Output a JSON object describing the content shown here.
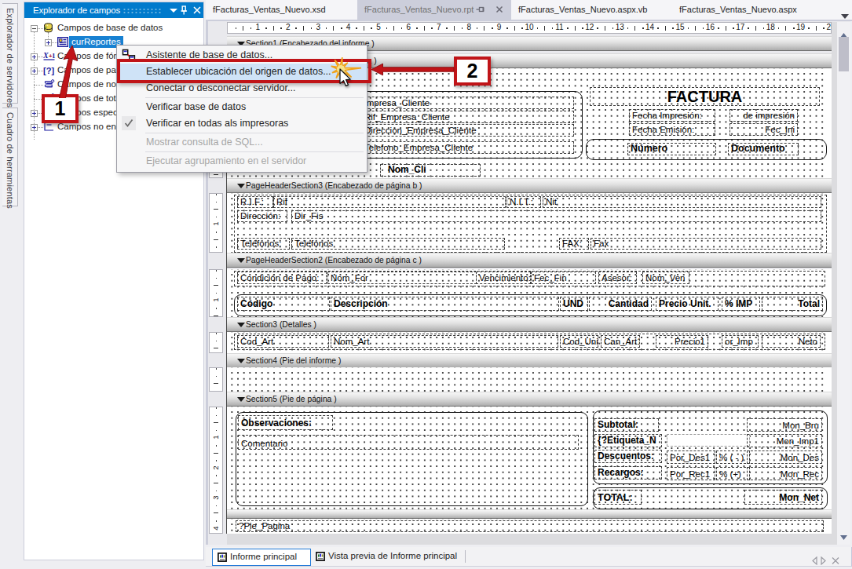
{
  "left_dock": {
    "tabs": [
      {
        "label": "Explorador de servidores"
      },
      {
        "label": "Cuadro de herramientas"
      }
    ]
  },
  "field_explorer": {
    "title": "Explorador de campos",
    "tree": [
      {
        "label": "Campos de base de datos",
        "level": 0,
        "expander": "minus",
        "icon": "database-fields-icon",
        "selected": false
      },
      {
        "label": "curReportes",
        "level": 1,
        "expander": "plus",
        "icon": "cursor-fields-icon",
        "selected": true
      },
      {
        "label": "Campos de fórmula",
        "level": 0,
        "expander": "plus",
        "icon": "formula-fields-icon",
        "selected": false
      },
      {
        "label": "Campos de parámetro",
        "level": 0,
        "expander": "plus",
        "icon": "parameter-fields-icon",
        "selected": false
      },
      {
        "label": "Campos de nombre de grupo",
        "level": 0,
        "expander": "none",
        "icon": "group-name-fields-icon",
        "selected": false
      },
      {
        "label": "Campos de totales acumulados",
        "level": 0,
        "expander": "none",
        "icon": "running-total-fields-icon",
        "selected": false
      },
      {
        "label": "Campos especiales",
        "level": 0,
        "expander": "plus",
        "icon": "special-fields-icon",
        "selected": false
      },
      {
        "label": "Campos no enlazados",
        "level": 0,
        "expander": "plus",
        "icon": "unbound-fields-icon",
        "selected": false
      }
    ]
  },
  "context_menu": {
    "items": [
      {
        "label": "Asistente de base de datos...",
        "icon": "database-expert-icon"
      },
      {
        "label": "Establecer ubicación del origen de datos...",
        "highlighted": true
      },
      {
        "label": "Conectar o desconectar servidor..."
      },
      {
        "type": "separator"
      },
      {
        "label": "Verificar base de datos"
      },
      {
        "label": "Verificar en todas als impresoras",
        "checked": true
      },
      {
        "type": "separator"
      },
      {
        "label": "Mostrar consulta de SQL...",
        "disabled": true
      },
      {
        "type": "separator"
      },
      {
        "label": "Ejecutar agrupamiento en el servidor",
        "disabled": true
      }
    ]
  },
  "annotations": {
    "step1": "1",
    "step2": "2"
  },
  "document_tabs": [
    {
      "label": "fFacturas_Ventas_Nuevo.xsd",
      "active": false
    },
    {
      "label": "fFacturas_Ventas_Nuevo.rpt",
      "active": true
    },
    {
      "label": "fFacturas_Ventas_Nuevo.aspx.vb",
      "active": false
    },
    {
      "label": "fFacturas_Ventas_Nuevo.aspx",
      "active": false
    }
  ],
  "designer": {
    "h_ruler_max": 20,
    "bands": [
      {
        "name": "Section1 (Encabezado del informe )"
      },
      {
        "name": "Section2 (Encabezado de página a )"
      },
      {
        "name": "PageHeaderSection3 (Encabezado de página b )"
      },
      {
        "name": "PageHeaderSection2 (Encabezado de página c )"
      },
      {
        "name": "Section3 (Detalles  )"
      },
      {
        "name": "Section4 (Pie del informe  )"
      },
      {
        "name": "Section5 (Pie de página  )"
      }
    ],
    "section_a": {
      "client_fields": [
        "Empresa_Cliente",
        "Rif_Empresa_Cliente",
        "Direccion_Empresa_Cliente",
        "Telefono_Empresa_Cliente"
      ],
      "nom_cli": "Nom_Cli",
      "title": "FACTURA",
      "fecha_impresion_label": "Fecha Impresión:",
      "fecha_impresion_value": "de impresión",
      "fecha_emision_label": "Fecha Emisión:",
      "fecha_emision_value": "Fec_Ini",
      "numero": "Número",
      "documento": "Documento"
    },
    "section_b": {
      "rif_label": "R.I.F.:",
      "rif": "Rif",
      "nit_label": "N.I.T.:",
      "nit": "Nit",
      "dir_label": "Dirección:",
      "dir": "Dir_Fis",
      "tel_label": "Teléfonos:",
      "tel": "Telefonos",
      "fax_label": "FAX:",
      "fax": "Fax"
    },
    "section_c": {
      "cond_label": "Condición de Pago:",
      "nom_for": "Nom_For",
      "venc_label": "Vencimiento:",
      "fec_fin": "Fec_Fin",
      "asesor_label": "Asesor:",
      "nom_ven": "Nom_Ven",
      "col_headers": [
        "Código",
        "Descripción",
        "UND",
        "Cantidad",
        "Precio Unit.",
        "% IMP",
        "Total"
      ]
    },
    "details": [
      "Cod_Art",
      "Nom_Art",
      "Cod_Uni",
      "Can_Art1",
      "Precio1",
      "or_Imp",
      "Neto"
    ],
    "section_footer": {
      "obs_label": "Observaciones:",
      "comentario": "Comentario",
      "subtotal_label": "Subtotal:",
      "mon_bru": "Mon_Bru",
      "etiqueta": "{?Etiqueta_N",
      "mon_imp": "Mon_Imp1",
      "desc_label": "Descuentos:",
      "por_des": "Por_Des1",
      "pct_des": "% ( - )",
      "mon_des": "Mon_Des",
      "rec_label": "Recargos:",
      "por_rec": "Por_Rec1",
      "pct_rec": "% (+)",
      "mon_rec": "Mon_Rec",
      "total_label": "TOTAL:",
      "mon_net": "Mon_Net",
      "pie_pagina": "?Pie_Pagina"
    }
  },
  "report_tabs": [
    {
      "label": "Informe principal",
      "active": true
    },
    {
      "label": "Vista previa de Informe principal",
      "active": false
    }
  ],
  "colors": {
    "accent_blue": "#007ACC",
    "selection_blue": "#1781D2",
    "annotation_red": "#C01418",
    "menu_highlight": "#CFE3F7",
    "active_tab_gray": "#CCCEDB"
  }
}
